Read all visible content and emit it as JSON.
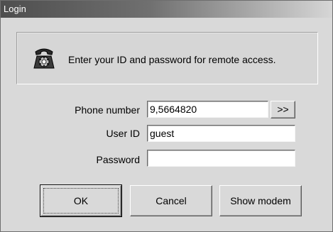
{
  "window": {
    "title": "Login"
  },
  "info": {
    "icon": "telephone-icon",
    "message": "Enter your ID and password for remote access."
  },
  "form": {
    "phone_label": "Phone number",
    "phone_value": "9,5664820",
    "browse_label": ">>",
    "userid_label": "User ID",
    "userid_value": "guest",
    "password_label": "Password",
    "password_value": ""
  },
  "buttons": {
    "ok": "OK",
    "cancel": "Cancel",
    "show_modem": "Show modem"
  }
}
